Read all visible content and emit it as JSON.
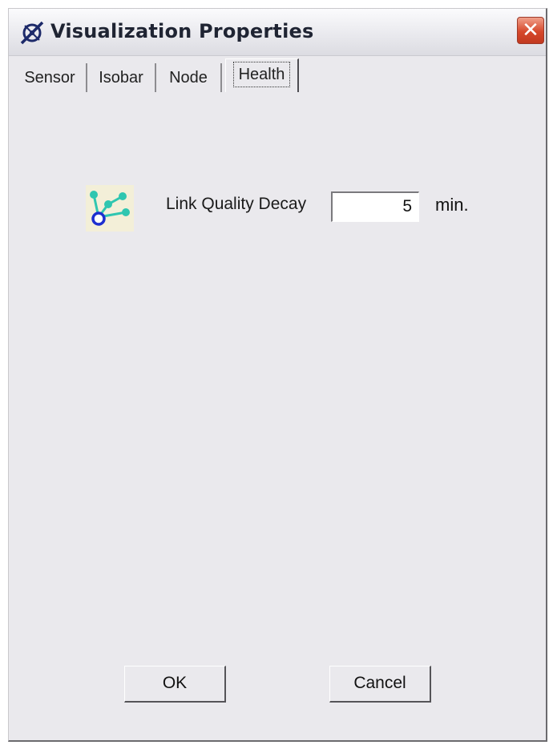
{
  "window": {
    "title": "Visualization Properties",
    "close_glyph": "✕"
  },
  "tabs": [
    {
      "label": "Sensor"
    },
    {
      "label": "Isobar"
    },
    {
      "label": "Node"
    },
    {
      "label": "Health",
      "selected": true
    }
  ],
  "health": {
    "icon": "network-links-icon",
    "link_quality_label": "Link Quality Decay",
    "link_quality_value": "5",
    "unit": "min."
  },
  "buttons": {
    "ok_label": "OK",
    "cancel_label": "Cancel"
  },
  "colors": {
    "close_red": "#d6482b",
    "icon_teal": "#2fc6b0",
    "icon_blue": "#1d2fd0"
  }
}
